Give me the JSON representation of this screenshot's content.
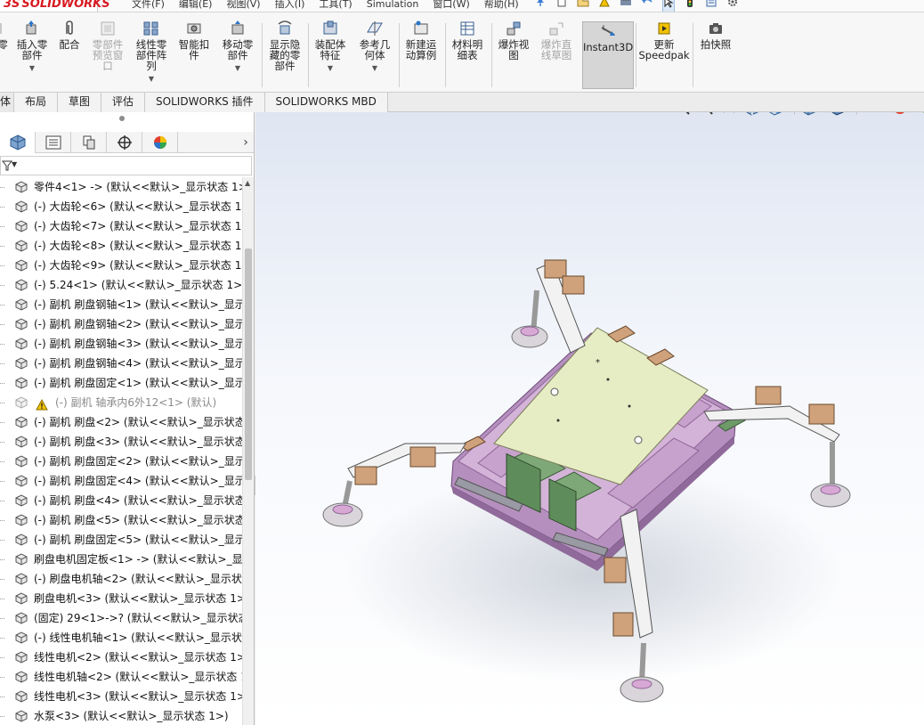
{
  "app": {
    "brand_ds": "3S",
    "brand_name": "SOLIDWORKS"
  },
  "menu": [
    "文件(F)",
    "编辑(E)",
    "视图(V)",
    "插入(I)",
    "工具(T)",
    "Simulation",
    "窗口(W)",
    "帮助(H)"
  ],
  "commands": [
    {
      "label": "零",
      "disabled": false
    },
    {
      "label": "插入零\n部件",
      "disabled": false
    },
    {
      "label": "配合",
      "disabled": false
    },
    {
      "label": "零部件\n预览窗\n口",
      "disabled": true
    },
    {
      "label": "线性零\n部件阵\n列",
      "disabled": false
    },
    {
      "label": "智能扣\n件",
      "disabled": false
    },
    {
      "label": "移动零\n部件",
      "disabled": false
    },
    {
      "label": "显示隐\n藏的零\n部件",
      "disabled": false
    },
    {
      "label": "装配体\n特征",
      "disabled": false
    },
    {
      "label": "参考几\n何体",
      "disabled": false
    },
    {
      "label": "新建运\n动算例",
      "disabled": false
    },
    {
      "label": "材料明\n细表",
      "disabled": false
    },
    {
      "label": "爆炸视\n图",
      "disabled": false
    },
    {
      "label": "爆炸直\n线草图",
      "disabled": true
    },
    {
      "label": "Instant3D",
      "disabled": false,
      "pressed": true
    },
    {
      "label": "更新\nSpeedpak",
      "disabled": false
    },
    {
      "label": "拍快照",
      "disabled": false
    }
  ],
  "tabs": [
    "体",
    "布局",
    "草图",
    "评估",
    "SOLIDWORKS 插件",
    "SOLIDWORKS MBD"
  ],
  "tree_items": [
    {
      "text": "零件4<1> -> (默认<<默认>_显示状态 1>)",
      "state": "normal"
    },
    {
      "text": "(-) 大齿轮<6> (默认<<默认>_显示状态 1>",
      "state": "normal"
    },
    {
      "text": "(-) 大齿轮<7> (默认<<默认>_显示状态 1>",
      "state": "normal"
    },
    {
      "text": "(-) 大齿轮<8> (默认<<默认>_显示状态 1>",
      "state": "normal"
    },
    {
      "text": "(-) 大齿轮<9> (默认<<默认>_显示状态 1>",
      "state": "normal"
    },
    {
      "text": "(-) 5.24<1> (默认<<默认>_显示状态 1>)",
      "state": "normal"
    },
    {
      "text": "(-) 副机 刷盘钢轴<1> (默认<<默认>_显示状",
      "state": "normal"
    },
    {
      "text": "(-) 副机 刷盘钢轴<2> (默认<<默认>_显示状",
      "state": "normal"
    },
    {
      "text": "(-) 副机 刷盘钢轴<3> (默认<<默认>_显示状",
      "state": "normal"
    },
    {
      "text": "(-) 副机 刷盘钢轴<4> (默认<<默认>_显示状",
      "state": "normal"
    },
    {
      "text": "(-) 副机 刷盘固定<1> (默认<<默认>_显示状",
      "state": "normal"
    },
    {
      "text": "(-) 副机 轴承内6外12<1> (默认)",
      "state": "warn"
    },
    {
      "text": "(-) 副机 刷盘<2> (默认<<默认>_显示状态",
      "state": "normal"
    },
    {
      "text": "(-) 副机 刷盘<3> (默认<<默认>_显示状态",
      "state": "normal"
    },
    {
      "text": "(-) 副机 刷盘固定<2> (默认<<默认>_显示状",
      "state": "normal"
    },
    {
      "text": "(-) 副机 刷盘固定<4> (默认<<默认>_显示状",
      "state": "normal"
    },
    {
      "text": "(-) 副机 刷盘<4> (默认<<默认>_显示状态",
      "state": "normal"
    },
    {
      "text": "(-) 副机 刷盘<5> (默认<<默认>_显示状态",
      "state": "normal"
    },
    {
      "text": "(-) 副机 刷盘固定<5> (默认<<默认>_显示状",
      "state": "normal"
    },
    {
      "text": "刷盘电机固定板<1> -> (默认<<默认>_显示",
      "state": "normal"
    },
    {
      "text": "(-) 刷盘电机轴<2> (默认<<默认>_显示状态",
      "state": "normal"
    },
    {
      "text": "刷盘电机<3> (默认<<默认>_显示状态 1>)",
      "state": "normal"
    },
    {
      "text": "(固定) 29<1>->? (默认<<默认>_显示状态",
      "state": "normal"
    },
    {
      "text": "(-) 线性电机轴<1> (默认<<默认>_显示状态",
      "state": "normal"
    },
    {
      "text": "线性电机<2> (默认<<默认>_显示状态 1>)",
      "state": "normal"
    },
    {
      "text": "线性电机轴<2> (默认<<默认>_显示状态 1",
      "state": "normal"
    },
    {
      "text": "线性电机<3> (默认<<默认>_显示状态 1>)",
      "state": "normal"
    },
    {
      "text": "水泵<3> (默认<<默认>_显示状态 1>)",
      "state": "normal"
    }
  ],
  "colors": {
    "platform_top": "#e6ecc3",
    "frame_purple": "#c9a6cf",
    "frame_edge": "#9a6aa3",
    "bracket_tan": "#cfa27c",
    "arm_white": "#f2f2f2",
    "foot_pink": "#d8a8d5",
    "foot_base": "#d9d5da",
    "pcb_green": "#6e9a6a",
    "selected_cmd": "#d6d6d6"
  }
}
